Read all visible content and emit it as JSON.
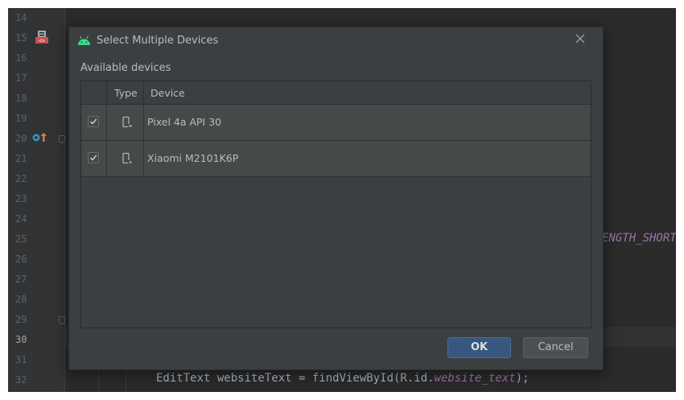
{
  "editor": {
    "line_numbers": [
      "14",
      "15",
      "16",
      "17",
      "18",
      "19",
      "20",
      "21",
      "22",
      "23",
      "24",
      "25",
      "26",
      "27",
      "28",
      "29",
      "30",
      "31",
      "32"
    ],
    "current_line": "30",
    "code_line_25_fragment": "ENGTH_SHORT",
    "code_line_32": {
      "prefix": "EditText websiteText = findViewById(R.id.",
      "field": "website_text",
      "suffix": ");"
    }
  },
  "dialog": {
    "title": "Select Multiple Devices",
    "section_label": "Available devices",
    "columns": {
      "type": "Type",
      "device": "Device"
    },
    "devices": [
      {
        "name": "Pixel 4a API 30",
        "checked": true,
        "icon": "virtual-device-icon"
      },
      {
        "name": "Xiaomi M2101K6P",
        "checked": true,
        "icon": "physical-device-icon"
      }
    ],
    "ok_label": "OK",
    "cancel_label": "Cancel",
    "colors": {
      "accent": "#365880",
      "android_green": "#3ddc84"
    }
  }
}
